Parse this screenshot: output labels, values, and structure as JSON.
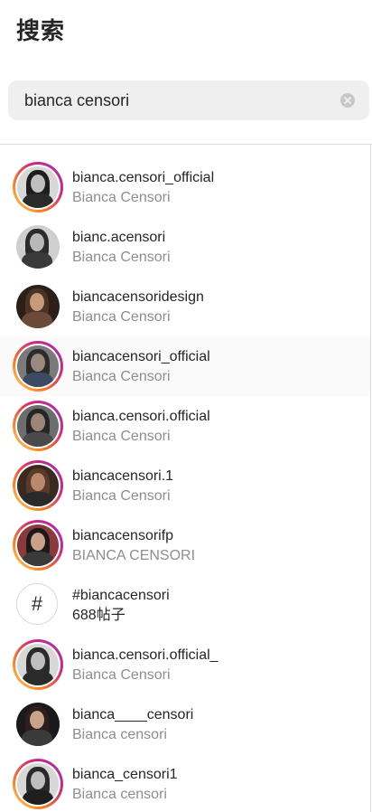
{
  "header": {
    "title": "搜索"
  },
  "search": {
    "value": "bianca censori"
  },
  "results": [
    {
      "username": "bianca.censori_official",
      "fullname": "Bianca Censori",
      "ring": true,
      "type": "user",
      "photo": [
        "#d7d7d7",
        "#1e1e1e",
        "#bfbfbf",
        "#2a2a2a"
      ]
    },
    {
      "username": "bianc.acensori",
      "fullname": "Bianca Censori",
      "ring": false,
      "type": "user",
      "photo": [
        "#cfcfcf",
        "#2b2b2b",
        "#b8b8b8",
        "#3a3a3a"
      ]
    },
    {
      "username": "biancacensoridesign",
      "fullname": "Bianca Censori",
      "ring": false,
      "type": "user",
      "photo": [
        "#2b1f18",
        "#4a3325",
        "#c79a7a",
        "#6b4a3a"
      ]
    },
    {
      "username": "biancacensori_official",
      "fullname": "Bianca Censori",
      "ring": true,
      "type": "user",
      "highlight": true,
      "photo": [
        "#7a7a7a",
        "#2c2c2c",
        "#9a8a7e",
        "#3c4a63"
      ]
    },
    {
      "username": "bianca.censori.official",
      "fullname": "Bianca Censori",
      "ring": true,
      "type": "user",
      "photo": [
        "#6d6d6d",
        "#262626",
        "#9c8677",
        "#4a4a4a"
      ]
    },
    {
      "username": "biancacensori.1",
      "fullname": "Bianca Censori",
      "ring": true,
      "type": "user",
      "photo": [
        "#3a2a22",
        "#5a3a2a",
        "#b88a6a",
        "#2a2a2a"
      ]
    },
    {
      "username": "biancacensorifp",
      "fullname": "BIANCA CENSORI",
      "ring": true,
      "type": "user",
      "photo": [
        "#8a3a3a",
        "#1a1a1a",
        "#c9a08a",
        "#3a3a3a"
      ]
    },
    {
      "username": "#biancacensori",
      "fullname": "688帖子",
      "ring": false,
      "type": "hashtag",
      "icon": "hashtag-icon"
    },
    {
      "username": "bianca.censori.official_",
      "fullname": "Bianca Censori",
      "ring": true,
      "type": "user",
      "photo": [
        "#d7d7d7",
        "#2a2a2a",
        "#bfbfbf",
        "#2a2a2a"
      ]
    },
    {
      "username": "bianca____censori",
      "fullname": "Bianca censori",
      "ring": false,
      "type": "user",
      "photo": [
        "#1a1a1a",
        "#2a1f1a",
        "#c9a28a",
        "#3a3a3a"
      ]
    },
    {
      "username": "bianca_censori1",
      "fullname": "Bianca censori",
      "ring": true,
      "type": "user",
      "photo": [
        "#d7d7d7",
        "#2a2a2a",
        "#bfbfbf",
        "#1e1e1e"
      ]
    }
  ],
  "icons": {
    "clear": "clear-search-icon"
  },
  "colors": {
    "text_primary": "#262626",
    "text_secondary": "#8e8e8e",
    "search_bg": "#efefef",
    "ring_start": "#feda75",
    "ring_end": "#962fbf"
  }
}
